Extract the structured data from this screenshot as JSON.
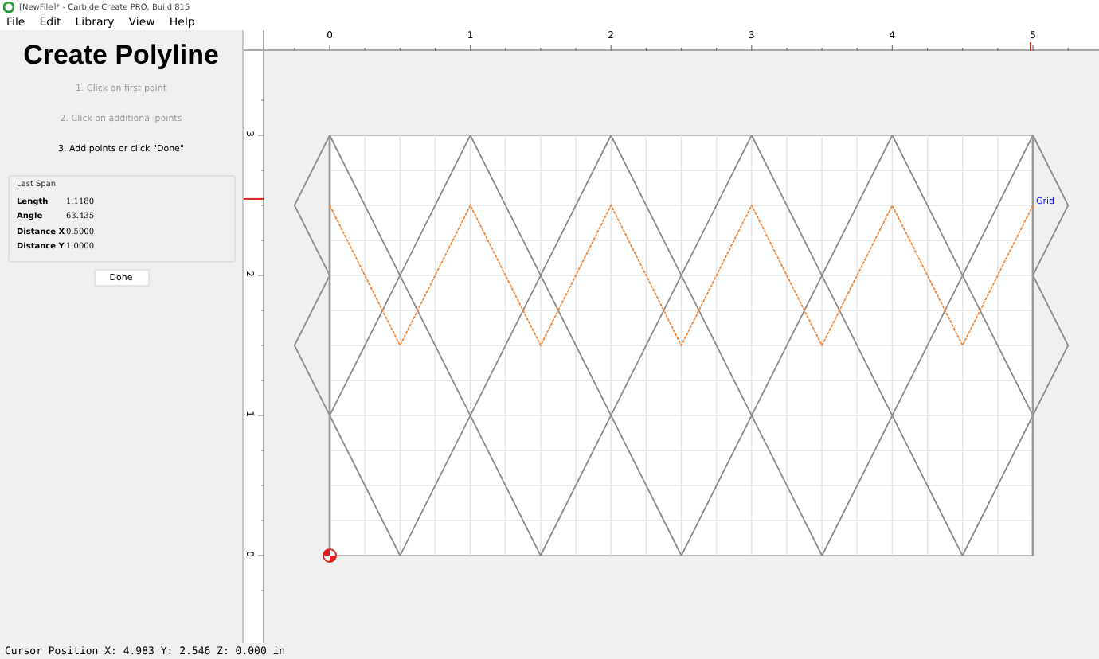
{
  "window": {
    "title": "[NewFile]* - Carbide Create PRO, Build 815"
  },
  "menu": [
    "File",
    "Edit",
    "Library",
    "View",
    "Help"
  ],
  "panel": {
    "title": "Create Polyline",
    "steps": [
      {
        "text": "1. Click on first point",
        "completed": true
      },
      {
        "text": "2. Click on additional points",
        "completed": true
      },
      {
        "text": "3. Add points or click \"Done\"",
        "completed": false
      }
    ],
    "last_span": {
      "title": "Last Span",
      "rows": [
        {
          "label": "Length",
          "value": "1.1180"
        },
        {
          "label": "Angle",
          "value": "63.435"
        },
        {
          "label": "Distance X",
          "value": "0.5000"
        },
        {
          "label": "Distance Y",
          "value": "1.0000"
        }
      ]
    },
    "done_button": "Done"
  },
  "rulers": {
    "horizontal": [
      "0",
      "1",
      "2",
      "3",
      "4",
      "5"
    ],
    "vertical": [
      "0",
      "1",
      "2",
      "3"
    ]
  },
  "canvas": {
    "grid_label": "Grid"
  },
  "status_bar": "Cursor Position X: 4.983 Y: 2.546 Z: 0.000 in"
}
